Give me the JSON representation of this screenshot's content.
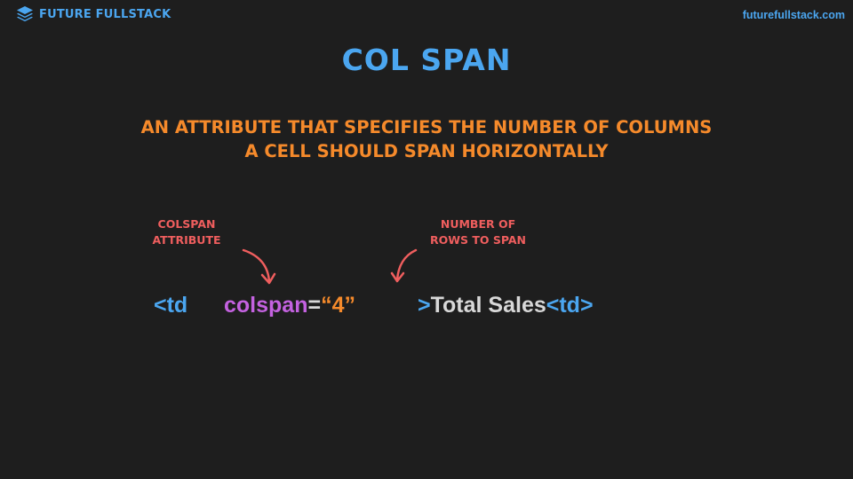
{
  "brand": {
    "name": "FUTURE FULLSTACK",
    "icon": "stacked-layers-icon",
    "url": "futurefullstack.com"
  },
  "slide": {
    "title": "COL SPAN",
    "definition_line1": "AN ATTRIBUTE THAT SPECIFIES THE NUMBER OF COLUMNS",
    "definition_line2": "A CELL SHOULD SPAN HORIZONTALLY"
  },
  "annotations": {
    "colspan_line1": "COLSPAN",
    "colspan_line2": "ATTRIBUTE",
    "rows_line1": "NUMBER OF",
    "rows_line2": "ROWS TO SPAN"
  },
  "code": {
    "open_tag": "<td",
    "attr_name": "colspan",
    "equals": "=",
    "attr_value": "“4”",
    "tag_close": ">",
    "content": "Total Sales",
    "close_tag": "<td>"
  },
  "colors": {
    "background": "#1e1e1e",
    "blue": "#4ba6f0",
    "orange": "#f58a2b",
    "red": "#ef5e5e",
    "purple": "#c462e0",
    "white": "#d8d8d8"
  }
}
